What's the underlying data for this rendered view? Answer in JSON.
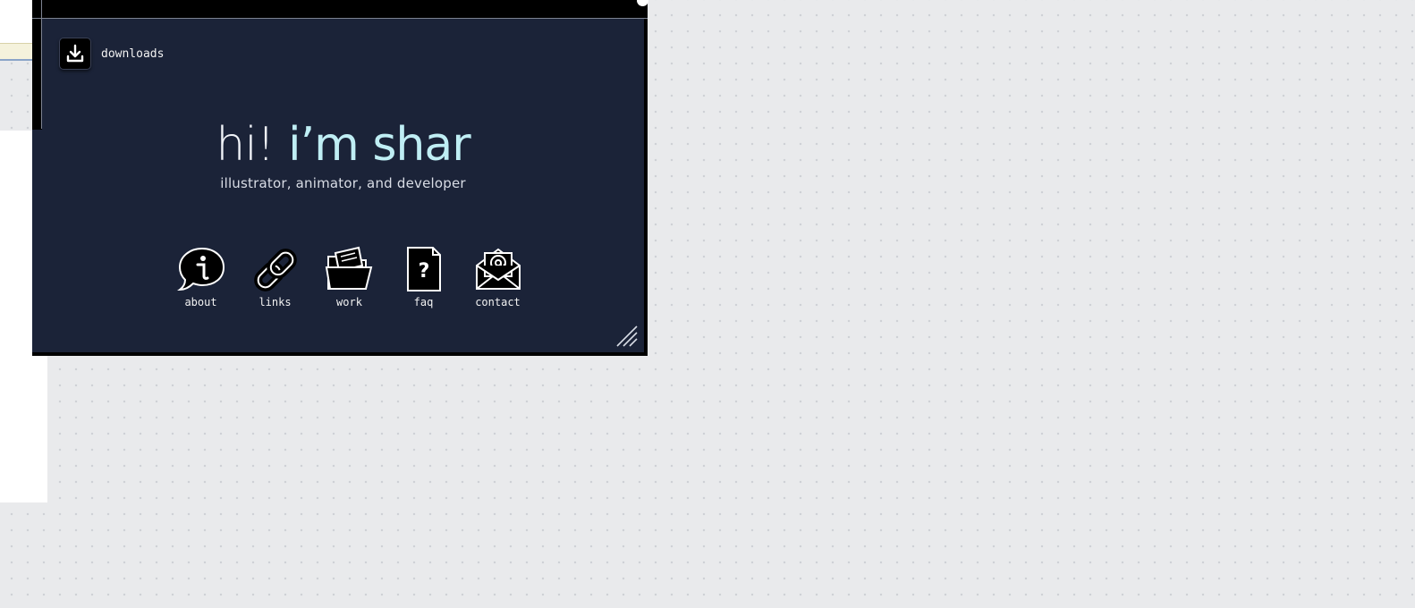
{
  "desktop": {
    "downloads_label": "downloads"
  },
  "hero": {
    "greeting": "hi! ",
    "name": "i’m shar",
    "subtitle": "illustrator, animator, and developer"
  },
  "nav": [
    {
      "label": "about",
      "icon": "info-bubble-icon"
    },
    {
      "label": "links",
      "icon": "chain-link-icon"
    },
    {
      "label": "work",
      "icon": "folder-icon"
    },
    {
      "label": "faq",
      "icon": "question-document-icon"
    },
    {
      "label": "contact",
      "icon": "envelope-at-icon"
    }
  ],
  "colors": {
    "window_bg": "#1b2338",
    "name_accent": "#bfeef4",
    "desktop_bg": "#e9eaec"
  }
}
